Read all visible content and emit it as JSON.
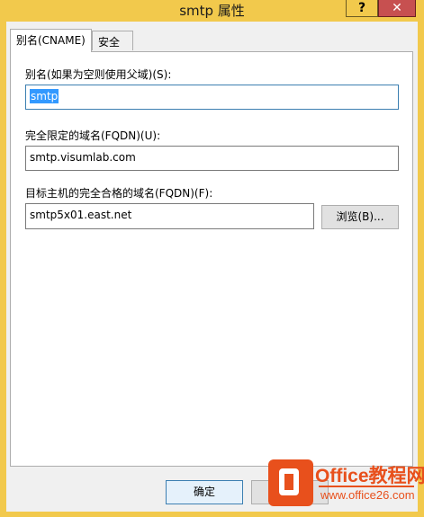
{
  "window": {
    "title": "smtp 属性",
    "help_label": "?",
    "close_label": "✕"
  },
  "tabs": [
    {
      "label": "别名(CNAME)",
      "active": true
    },
    {
      "label": "安全",
      "active": false
    }
  ],
  "form": {
    "alias_label": "别名(如果为空则使用父域)(S):",
    "alias_value": "smtp",
    "fqdn_label": "完全限定的域名(FQDN)(U):",
    "fqdn_value": "smtp.visumlab.com",
    "target_label": "目标主机的完全合格的域名(FQDN)(F):",
    "target_value": "smtp5x01.east.net",
    "browse_label": "浏览(B)..."
  },
  "footer": {
    "ok_label": "确定"
  },
  "watermark": {
    "line1": "Office教程网",
    "line2": "www.office26.com"
  }
}
